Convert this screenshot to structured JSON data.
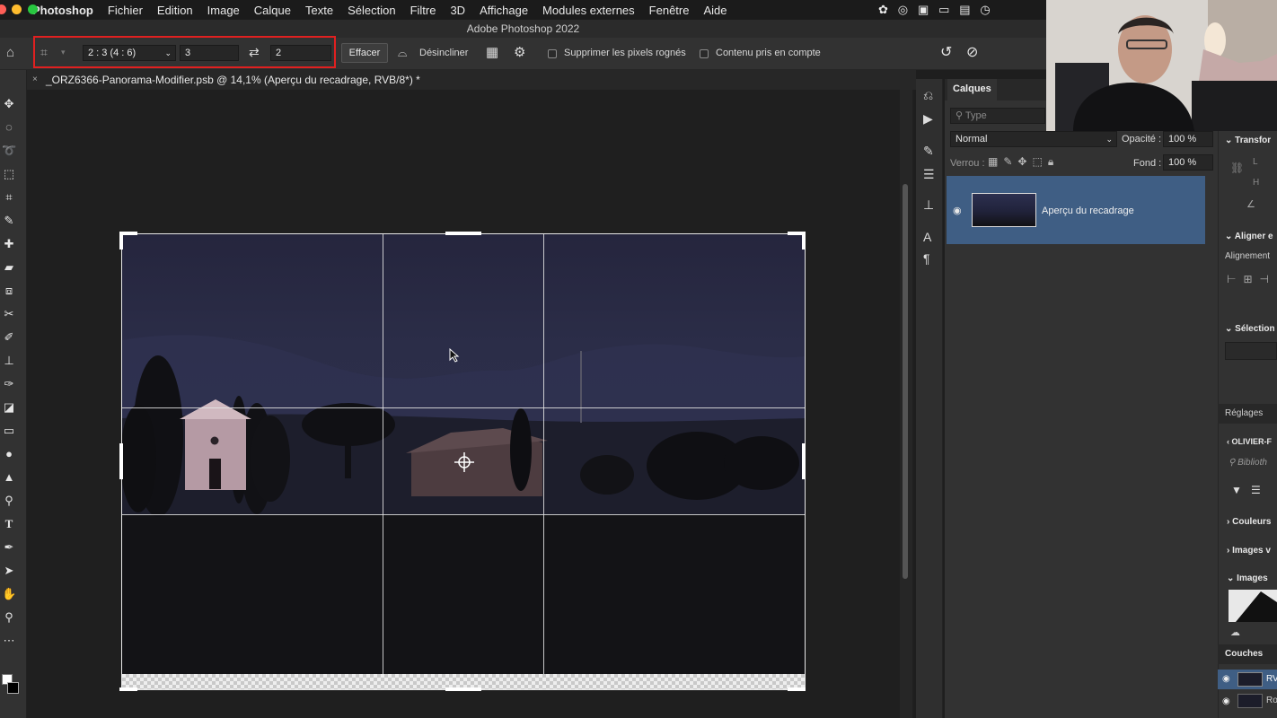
{
  "menubar": {
    "app": "Photoshop",
    "items": [
      "Fichier",
      "Edition",
      "Image",
      "Calque",
      "Texte",
      "Sélection",
      "Filtre",
      "3D",
      "Affichage",
      "Modules externes",
      "Fenêtre",
      "Aide"
    ]
  },
  "window": {
    "title": "Adobe Photoshop 2022"
  },
  "options": {
    "ratio_select": "2 : 3 (4 : 6)",
    "width_value": "3",
    "height_value": "2",
    "clear_button": "Effacer",
    "straighten_label": "Désincliner",
    "delete_pixels_label": "Supprimer les pixels rognés",
    "content_aware_label": "Contenu pris en compte"
  },
  "document": {
    "tab_title": "_ORZ6366-Panorama-Modifier.psb @ 14,1% (Aperçu du recadrage, RVB/8*) *"
  },
  "layers_panel": {
    "tab": "Calques",
    "search_placeholder": "Type",
    "blend_mode": "Normal",
    "opacity_label": "Opacité :",
    "opacity_value": "100 %",
    "lock_label": "Verrou :",
    "fill_label": "Fond :",
    "fill_value": "100 %",
    "layer_name": "Aperçu du recadrage"
  },
  "right_dock": {
    "transform": "Transfor",
    "transform_l": "L",
    "transform_h": "H",
    "align": "Aligner e",
    "alignment": "Alignement",
    "selection": "Sélection",
    "adjustments": "Réglages",
    "library": "OLIVIER-F",
    "library_search": "Biblioth",
    "colors": "Couleurs",
    "images_v": "Images v",
    "images": "Images",
    "channels": "Couches",
    "channel_1": "RV",
    "channel_2": "Ro"
  },
  "colors": {
    "accent_red": "#e02020",
    "layer_selected": "#3f5e84"
  }
}
